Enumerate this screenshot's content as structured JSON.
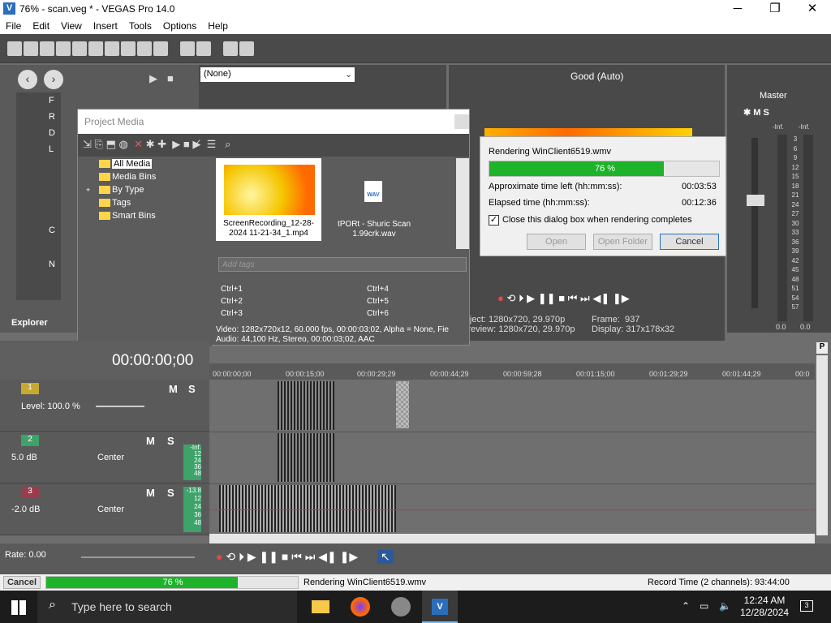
{
  "window": {
    "title": "76% - scan.veg * - VEGAS Pro 14.0",
    "minimize": "─",
    "maximize": "❐",
    "close": "✕"
  },
  "menu": [
    "File",
    "Edit",
    "View",
    "Insert",
    "Tools",
    "Options",
    "Help"
  ],
  "preview_toolbar": {
    "dropdown": "(None)",
    "quality": "Good (Auto)"
  },
  "explorer": {
    "tab": "Explorer",
    "tree": [
      "F",
      "R",
      "D",
      "L",
      "C",
      "N"
    ]
  },
  "project_media": {
    "title": "Project Media",
    "tree": [
      "All Media",
      "Media Bins",
      "By Type",
      "Tags",
      "Smart Bins"
    ],
    "tree_expander": "+",
    "items": [
      {
        "label": "ScreenRecording_12-28-2024 11-21-34_1.mp4"
      },
      {
        "label": "tPORt - Shuric Scan 1.99crk.wav",
        "icon_text": "WAV"
      }
    ],
    "tags_placeholder": "Add tags",
    "shortcuts": [
      "Ctrl+1",
      "Ctrl+4",
      "Ctrl+2",
      "Ctrl+5",
      "Ctrl+3",
      "Ctrl+6"
    ],
    "info_video": "Video: 1282x720x12, 60.000 fps, 00:00:03;02, Alpha = None, Fie",
    "info_audio": "Audio: 44,100 Hz, Stereo, 00:00:03;02, AAC"
  },
  "render_dialog": {
    "title": "Rendering WinClient6519.wmv",
    "progress_label": "76 %",
    "progress": 0.76,
    "time_left_label": "Approximate time left (hh:mm:ss):",
    "time_left": "00:03:53",
    "elapsed_label": "Elapsed time (hh:mm:ss):",
    "elapsed": "00:12:36",
    "close_check_label": "Close this dialog box when rendering completes",
    "open": "Open",
    "open_folder": "Open Folder",
    "cancel": "Cancel"
  },
  "preview_info": {
    "project_label": "roject:",
    "project": "1280x720, 29.970p",
    "preview_label": "Preview:",
    "preview": "1280x720, 29.970p",
    "frame_label": "Frame:",
    "frame": "937",
    "display_label": "Display:",
    "display": "317x178x32"
  },
  "master": {
    "title": "Master",
    "scale": [
      "-Inf.",
      "3",
      "6",
      "9",
      "12",
      "15",
      "18",
      "21",
      "24",
      "27",
      "30",
      "33",
      "36",
      "39",
      "42",
      "45",
      "48",
      "51",
      "54",
      "57"
    ],
    "left": "0.0",
    "right": "0.0",
    "inf_l": "-Inf.",
    "inf_r": "-Inf."
  },
  "timeline": {
    "timecode": "00:00:00;00",
    "ruler": [
      "00:00:00;00",
      "00:00:15;00",
      "00:00:29;29",
      "00:00:44;29",
      "00:00:59;28",
      "00:01:15;00",
      "00:01:29;29",
      "00:01:44;29",
      "00:0"
    ],
    "marker": "P",
    "tracks": [
      {
        "num": "1",
        "level": "Level: 100.0 %",
        "m": "M",
        "s": "S"
      },
      {
        "num": "2",
        "vol": "5.0 dB",
        "pan": "Center",
        "m": "M",
        "s": "S",
        "meter": [
          "-Inf.",
          "12",
          "24",
          "36",
          "48"
        ]
      },
      {
        "num": "3",
        "vol": "-2.0 dB",
        "pan": "Center",
        "m": "M",
        "s": "S",
        "meter": [
          "-13.8",
          "12",
          "24",
          "36",
          "48"
        ]
      }
    ],
    "rate": "Rate: 0.00"
  },
  "status": {
    "cancel": "Cancel",
    "progress_label": "76 %",
    "progress": 0.76,
    "text": "Rendering WinClient6519.wmv",
    "record_time": "Record Time (2 channels): 93:44:00"
  },
  "taskbar": {
    "search_placeholder": "Type here to search",
    "time": "12:24 AM",
    "date": "12/28/2024",
    "notif": "3"
  },
  "colors": {
    "progress": "#1db32a",
    "accent": "#2a6ebb"
  }
}
